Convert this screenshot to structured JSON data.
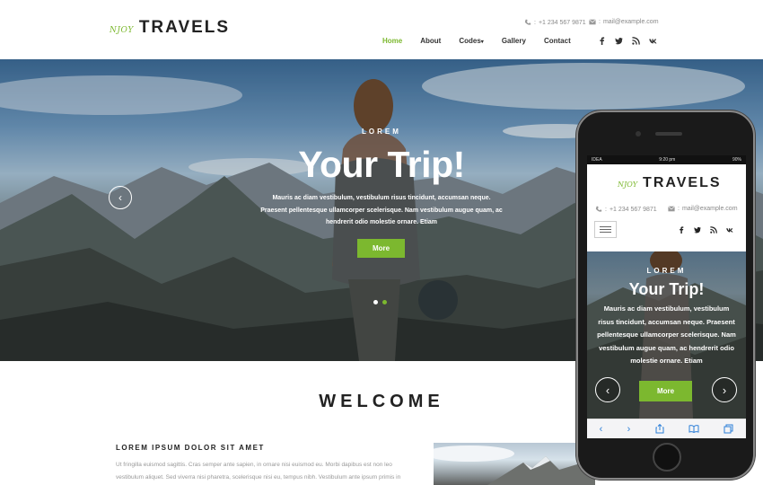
{
  "colors": {
    "accent": "#7cb82f",
    "text_dark": "#222222",
    "muted": "#888888"
  },
  "header": {
    "logo_small": "NJOY",
    "logo_main": "TRAVELS",
    "phone": "+1 234 567 9871",
    "phone_icon": "phone-icon",
    "email": "mail@example.com",
    "email_icon": "envelope-icon",
    "nav": [
      {
        "label": "Home",
        "active": true
      },
      {
        "label": "About"
      },
      {
        "label": "Codes"
      },
      {
        "label": "Gallery"
      },
      {
        "label": "Contact"
      }
    ],
    "social": [
      "facebook-icon",
      "twitter-icon",
      "rss-icon",
      "vk-icon"
    ]
  },
  "hero": {
    "eyebrow": "LOREM",
    "title": "Your Trip!",
    "text": "Mauris ac diam vestibulum, vestibulum risus tincidunt, accumsan neque. Praesent pellentesque ullamcorper scelerisque. Nam vestibulum augue quam, ac hendrerit odio molestie ornare. Etiam",
    "button": "More",
    "prev_icon": "chevron-left-icon",
    "slides": 2,
    "active_slide": 2
  },
  "welcome": {
    "title": "WELCOME",
    "heading": "LOREM IPSUM DOLOR SIT AMET",
    "text": "Ut fringilla euismod sagittis. Cras semper ante sapien, in ornare nisi euismod eu. Morbi dapibus est non leo vestibulum aliquet. Sed viverra nisi pharetra, scelerisque nisi eu, tempus nibh. Vestibulum ante ipsum primis in"
  },
  "phone": {
    "status_carrier": "IDEA",
    "status_time": "9:20 pm",
    "status_battery": "90%",
    "logo_small": "NJOY",
    "logo_main": "TRAVELS",
    "phone": "+1 234 567 9871",
    "email": "mail@example.com",
    "menu_icon": "hamburger-menu-icon",
    "hero_eyebrow": "LOREM",
    "hero_title": "Your Trip!",
    "hero_text": "Mauris ac diam vestibulum, vestibulum risus tincidunt, accumsan neque. Praesent pellentesque ullamcorper scelerisque. Nam vestibulum augue quam, ac hendrerit odio molestie ornare. Etiam",
    "hero_button": "More",
    "toolbar": [
      "back-icon",
      "forward-icon",
      "share-icon",
      "bookmarks-icon",
      "tabs-icon"
    ]
  }
}
